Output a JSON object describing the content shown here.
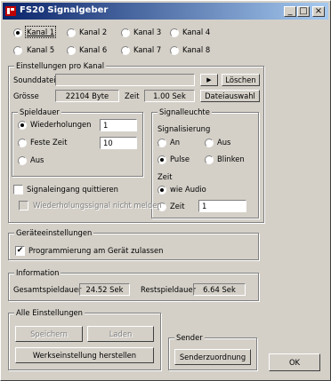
{
  "window": {
    "title": "FS20 Signalgeber"
  },
  "channels": [
    {
      "label": "Kanal 1",
      "selected": true
    },
    {
      "label": "Kanal 2",
      "selected": false
    },
    {
      "label": "Kanal 3",
      "selected": false
    },
    {
      "label": "Kanal 4",
      "selected": false
    },
    {
      "label": "Kanal 5",
      "selected": false
    },
    {
      "label": "Kanal 6",
      "selected": false
    },
    {
      "label": "Kanal 7",
      "selected": false
    },
    {
      "label": "Kanal 8",
      "selected": false
    }
  ],
  "per_channel": {
    "title": "Einstellungen pro Kanal",
    "sounddatei_label": "Sounddatei",
    "sounddatei_value": "",
    "play_symbol": "▶",
    "loeschen_label": "Löschen",
    "groesse_label": "Grösse",
    "groesse_value": "22104 Byte",
    "zeit_label": "Zeit",
    "zeit_value": "1.00 Sek",
    "dateiauswahl_label": "Dateiauswahl",
    "spieldauer": {
      "title": "Spieldauer",
      "wiederholungen_label": "Wiederholungen",
      "wiederholungen_value": "1",
      "feste_zeit_label": "Feste Zeit",
      "feste_zeit_value": "10",
      "aus_label": "Aus",
      "selected": "Wiederholungen"
    },
    "signalleuchte": {
      "title": "Signalleuchte",
      "signalisierung_label": "Signalisierung",
      "an_label": "An",
      "aus_label": "Aus",
      "pulse_label": "Pulse",
      "blinken_label": "Blinken",
      "selected": "Pulse",
      "zeit_label": "Zeit",
      "wie_audio_label": "wie Audio",
      "zeit_option_label": "Zeit",
      "zeit_value": "1",
      "zeit_selected": "wie Audio"
    },
    "signaleingang_label": "Signaleingang quittieren",
    "wiederholungssignal_label": "Wiederholungssignal nicht melden"
  },
  "device": {
    "title": "Geräteeinstellungen",
    "programmierung_label": "Programmierung am Gerät zulassen",
    "programmierung_checked": true
  },
  "information": {
    "title": "Information",
    "gesamt_label": "Gesamtspieldauer",
    "gesamt_value": "24.52 Sek",
    "rest_label": "Restspieldauer",
    "rest_value": "6.64 Sek"
  },
  "all_settings": {
    "title": "Alle Einstellungen",
    "speichern_label": "Speichern",
    "laden_label": "Laden",
    "werkseinstellung_label": "Werkseinstellung herstellen"
  },
  "sender": {
    "title": "Sender",
    "zuordnung_label": "Senderzuordnung"
  },
  "ok_label": "OK"
}
